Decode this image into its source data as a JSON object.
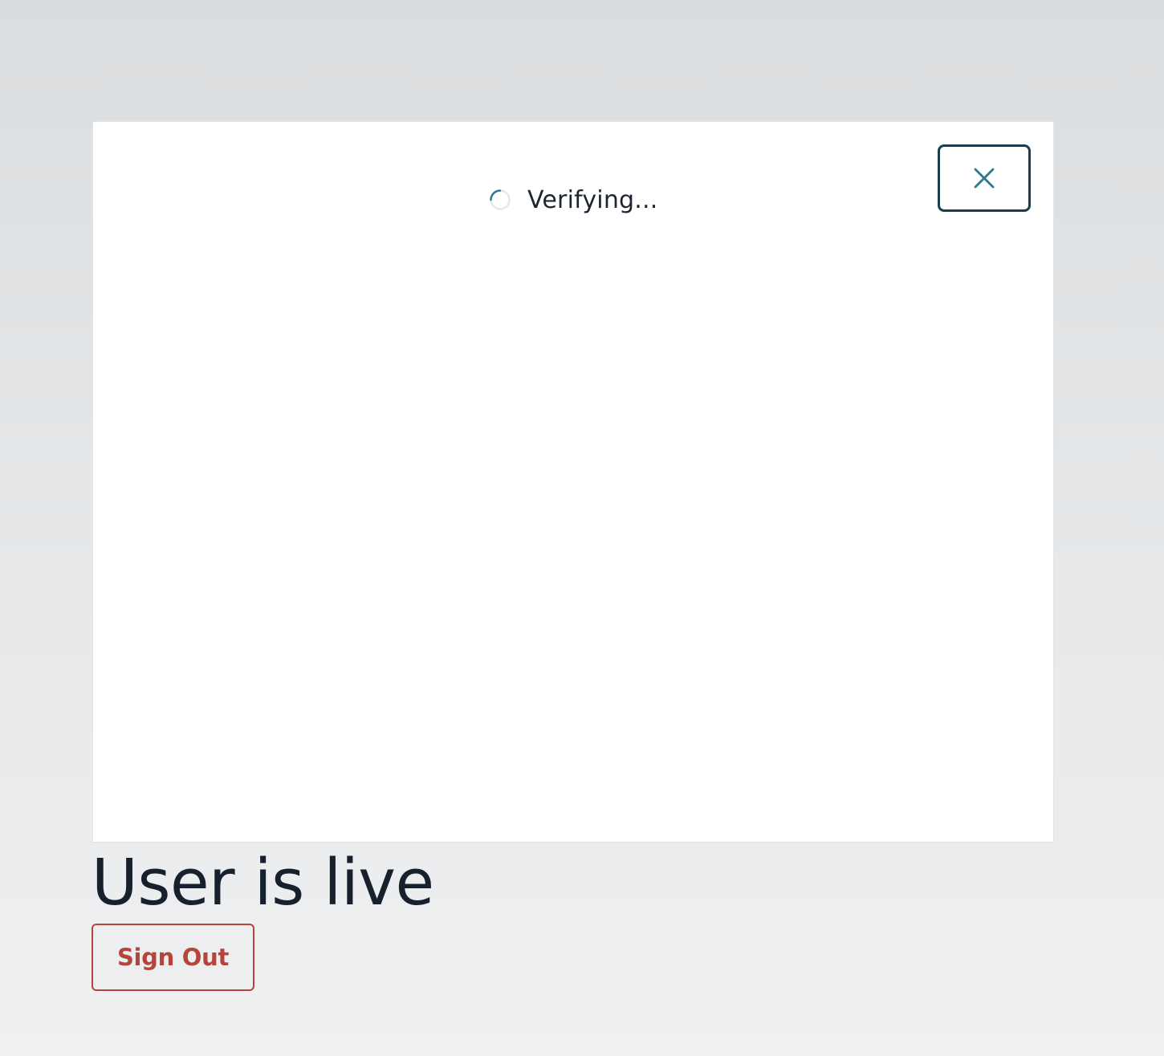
{
  "verification": {
    "status_text": "Verifying...",
    "spinner_icon": "loading-spinner-icon",
    "close_icon": "close-icon"
  },
  "main": {
    "heading": "User is live",
    "sign_out_label": "Sign Out"
  },
  "colors": {
    "accent": "#2f7a8c",
    "close_border": "#1b3f4c",
    "sign_out": "#b5453c",
    "text": "#17212d"
  }
}
